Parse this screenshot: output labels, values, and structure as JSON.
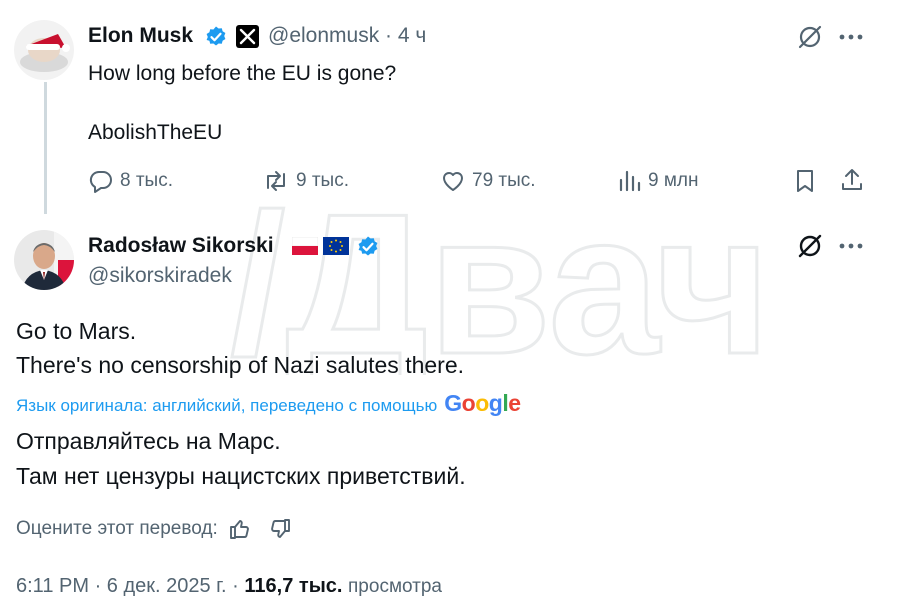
{
  "tweet1": {
    "name": "Elon Musk",
    "handle": "@elonmusk",
    "dot": "·",
    "time": "4 ч",
    "line1": "How long before the EU is gone?",
    "line2": "AbolishTheEU",
    "actions": {
      "replies": "8 тыс.",
      "retweets": "9 тыс.",
      "likes": "79 тыс.",
      "views": "9 млн"
    }
  },
  "tweet2": {
    "name": "Radosław Sikorski",
    "handle": "@sikorskiradek",
    "line1": "Go to Mars.",
    "line2": "There's no censorship of Nazi salutes there.",
    "translation_notice": "Язык оригинала: английский, переведено с помощью",
    "google": [
      "G",
      "o",
      "o",
      "g",
      "l",
      "e"
    ],
    "translated_line1": "Отправляйтесь на Марс.",
    "translated_line2": "Там нет цензуры нацистских приветствий.",
    "rate_label": "Оцените этот перевод:",
    "meta_time": "6:11 PM",
    "meta_date": "6 дек. 2025 г.",
    "meta_sep": "·",
    "views_count": "116,7 тыс.",
    "views_label": "просмотра"
  },
  "watermark_text": "/Двач",
  "colors": {
    "verified": "#1d9bf0",
    "text": "#0f1419",
    "muted": "#536471",
    "line": "#cfd9de",
    "google_blue": "#4285F4",
    "google_red": "#EA4335",
    "google_yellow": "#FBBC05",
    "google_green": "#34A853"
  }
}
